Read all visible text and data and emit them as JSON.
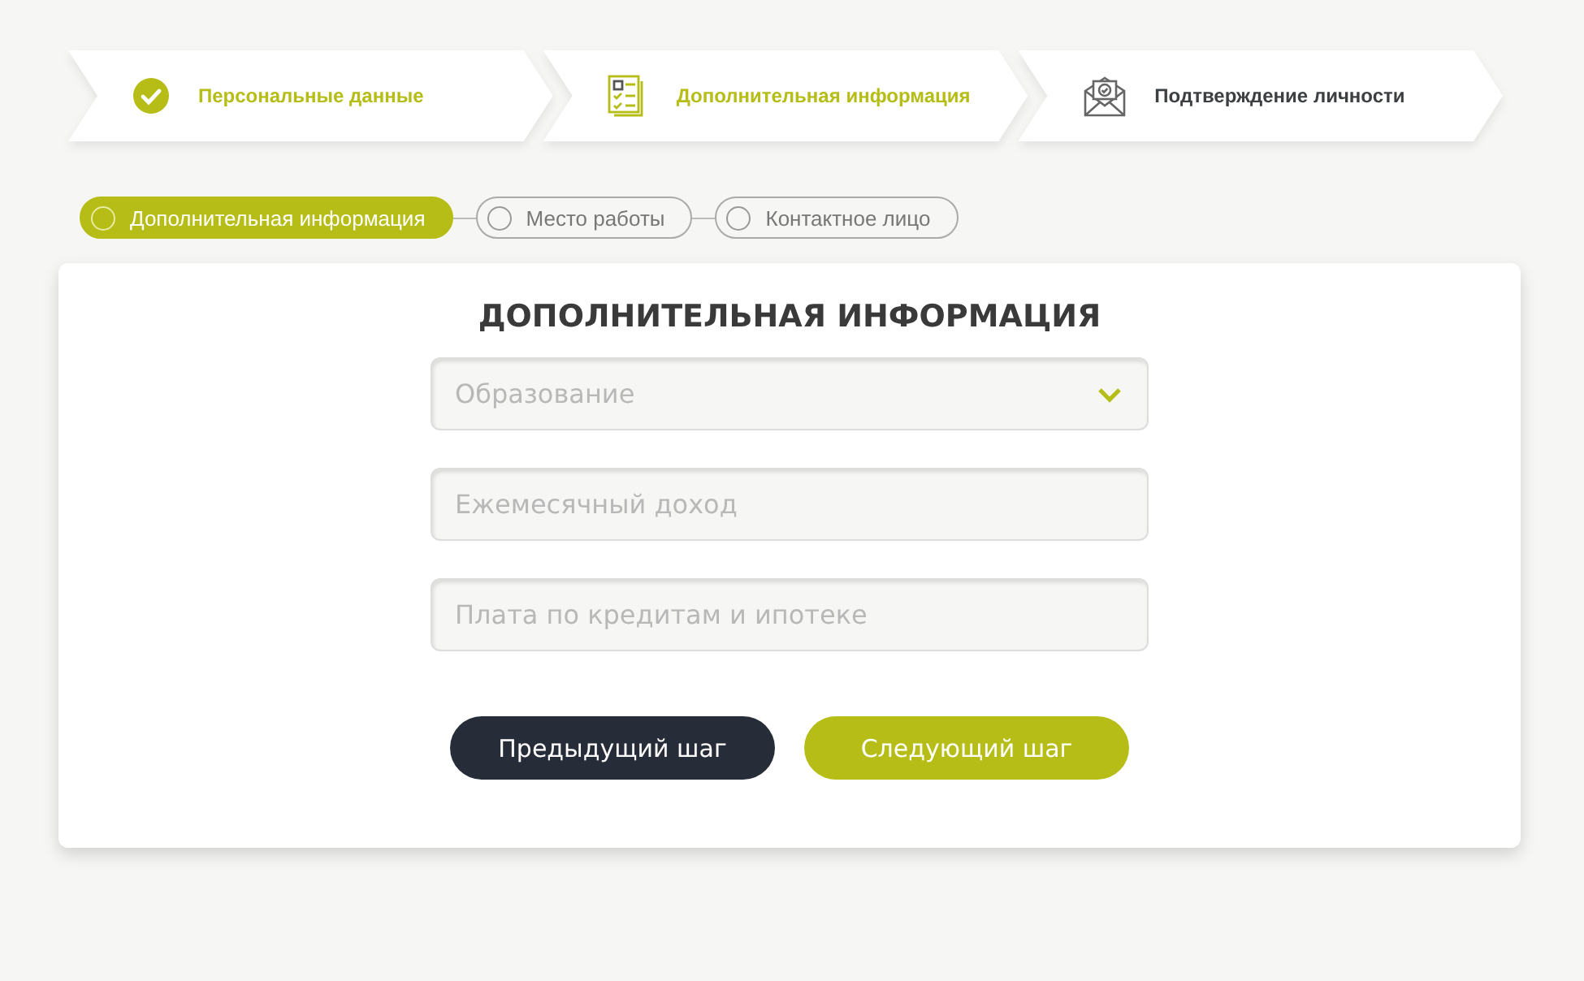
{
  "steps": [
    {
      "label": "Персональные данные",
      "kind": "done"
    },
    {
      "label": "Дополнительная информация",
      "kind": "current"
    },
    {
      "label": "Подтверждение личности",
      "kind": "pending"
    }
  ],
  "substeps": [
    {
      "label": "Дополнительная информация",
      "selected": true
    },
    {
      "label": "Место работы",
      "selected": false
    },
    {
      "label": "Контактное лицо",
      "selected": false
    }
  ],
  "form": {
    "title": "ДОПОЛНИТЕЛЬНАЯ ИНФОРМАЦИЯ",
    "fields": [
      {
        "kind": "select",
        "placeholder": "Образование"
      },
      {
        "kind": "input",
        "placeholder": "Ежемесячный доход"
      },
      {
        "kind": "input",
        "placeholder": "Плата по кредитам и ипотеке"
      }
    ],
    "buttons": [
      {
        "label": "Предыдущий шаг",
        "kind": "secondary"
      },
      {
        "label": "Следующий шаг",
        "kind": "primary"
      }
    ]
  }
}
